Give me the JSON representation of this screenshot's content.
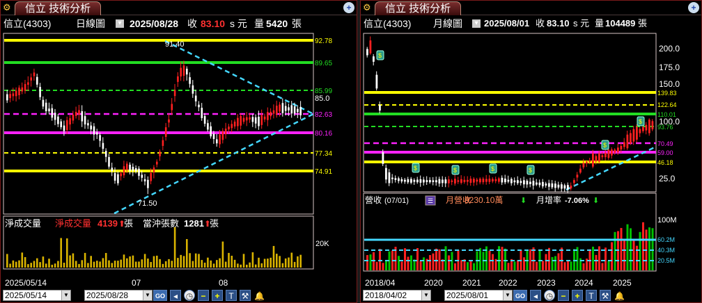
{
  "left": {
    "tab_title": "信立 技術分析",
    "stock": "信立(4303)",
    "chart_kind": "日線圖",
    "date": "2025/08/28",
    "close_label": "收",
    "close_value": "83.10",
    "close_suffix": "s 元",
    "volume_label": "量",
    "volume_value": "5420",
    "volume_unit": "張",
    "price_levels": [
      "92.78",
      "89.65",
      "85.99",
      "82.63",
      "80.16",
      "77.34",
      "74.91"
    ],
    "current_price": "85.0",
    "high_mark": "91.40",
    "low_mark": "71.50",
    "sub_title": "淨成交量",
    "sub_metric_label": "淨成交量",
    "sub_metric_value": "4139",
    "sub_metric_unit": "張",
    "sub_metric2_label": "當沖張數",
    "sub_metric2_value": "1281",
    "sub_metric2_unit": "張",
    "sub_axis_label": "20K",
    "x_labels": [
      "2025/05/14",
      "07",
      "08"
    ],
    "start_date": "2025/05/14",
    "end_date": "2025/08/28",
    "go_label": "GO"
  },
  "right": {
    "tab_title": "信立 技術分析",
    "stock": "信立(4303)",
    "chart_kind": "月線圖",
    "date": "2025/08/01",
    "close_label": "收",
    "close_value": "83.10",
    "close_suffix": "s 元",
    "volume_label": "量",
    "volume_value": "104489",
    "volume_unit": "張",
    "axis_ticks": [
      "200.0",
      "175.0",
      "150.0",
      "125.0",
      "100.0",
      "25.0"
    ],
    "price_levels": [
      "139.83",
      "122.64",
      "110.01",
      "93.76",
      "70.49",
      "59.00",
      "46.18"
    ],
    "sub_title": "營收",
    "sub_period": "(07/01)",
    "revenue_label": "月營收",
    "revenue_value": "9230.10萬",
    "mom_label": "月增率",
    "mom_value": "-7.06%",
    "sub_axis_labels": [
      "100M",
      "60.2M",
      "40.3M",
      "20.5M"
    ],
    "x_labels": [
      "2018/04",
      "2020",
      "2021",
      "2022",
      "2023",
      "2024",
      "2025"
    ],
    "start_date": "2018/04/02",
    "end_date": "2025/08/01",
    "go_label": "GO"
  },
  "colors": {
    "up": "#ff2020",
    "down": "#00c000",
    "yellow": "#ffff00",
    "green": "#22dd22",
    "magenta": "#ff22ff",
    "cyan": "#44d8ff",
    "volume": "#d9b300"
  },
  "icons": [
    "gear-icon",
    "zoom-icon",
    "back-icon",
    "clock-icon",
    "minus-icon",
    "plus-icon",
    "text-icon",
    "ruler-icon",
    "bell-icon"
  ]
}
